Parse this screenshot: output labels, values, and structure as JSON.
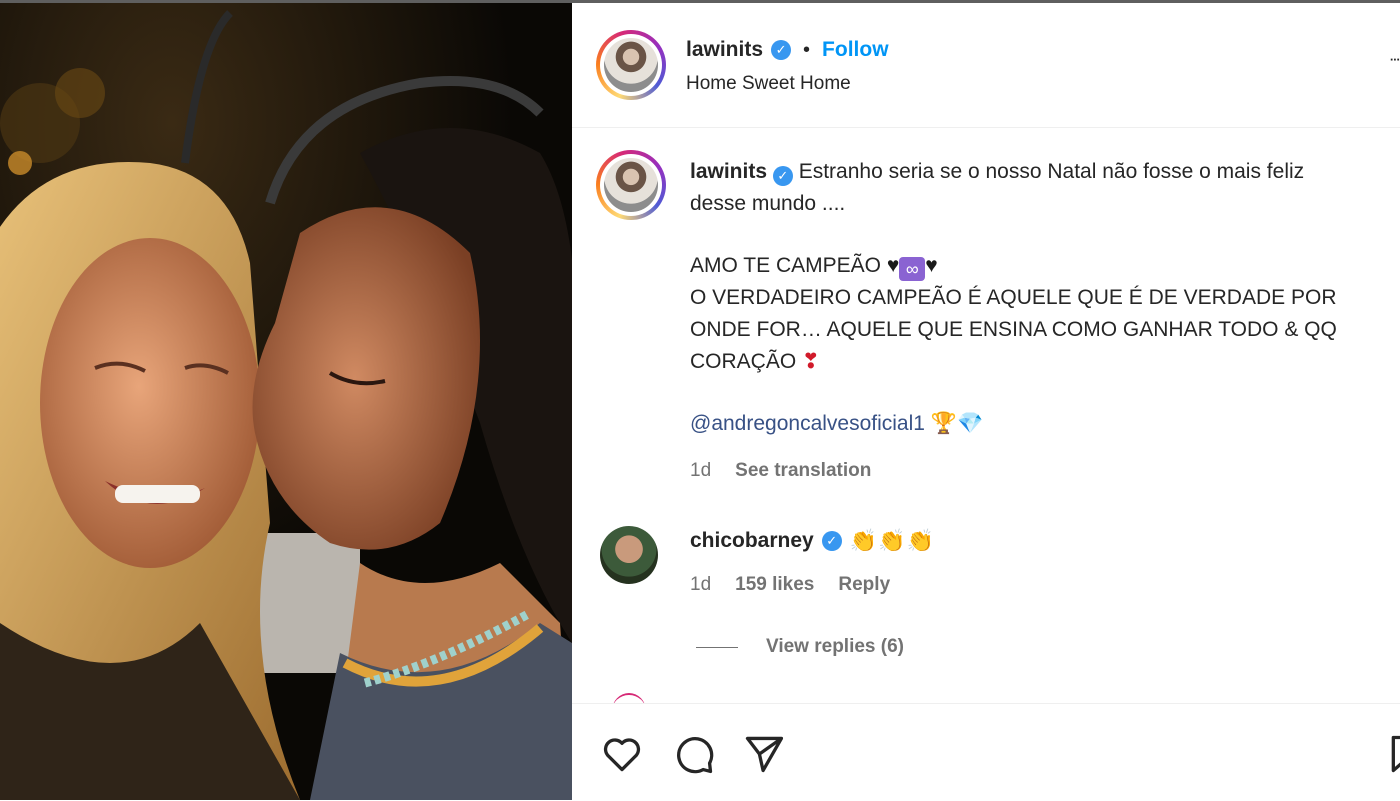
{
  "post": {
    "username": "lawinits",
    "location": "Home Sweet Home",
    "follow_label": "Follow",
    "separator": "•",
    "more": "⋯",
    "verified_mark": "✓"
  },
  "caption": {
    "username": "lawinits",
    "line1": "Estranho seria se o nosso Natal não fosse o mais feliz",
    "line2": "desse mundo ....",
    "line3_text": "AMO TE CAMPEÃO",
    "line3_heart": "♥",
    "line3_infinity": "∞",
    "line4": "O VERDADEIRO CAMPEÃO É AQUELE QUE É DE VERDADE POR",
    "line5": "ONDE FOR… AQUELE QUE ENSINA COMO GANHAR TODO & QQ",
    "line6_text": "CORAÇÃO",
    "line6_emoji": "❣",
    "mention": "@andregoncalvesoficial1",
    "mention_emojis": "🏆💎",
    "time": "1d",
    "see_translation": "See translation"
  },
  "comment": {
    "username": "chicobarney",
    "text": "👏👏👏",
    "time": "1d",
    "likes": "159 likes",
    "reply": "Reply",
    "view_replies": "View replies (6)"
  },
  "icons": {
    "like": "heart-icon",
    "comment": "comment-icon",
    "share": "share-icon",
    "save": "bookmark-icon"
  },
  "colors": {
    "follow": "#0095f6",
    "verified": "#3897f0",
    "muted": "#737373",
    "mention": "#00376b"
  }
}
